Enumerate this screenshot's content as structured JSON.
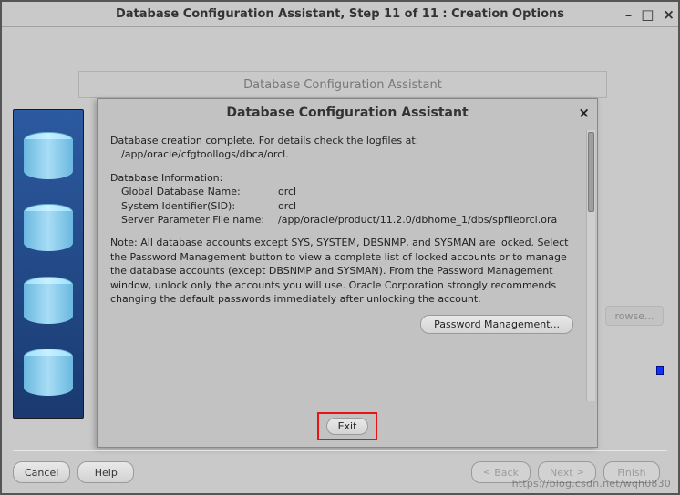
{
  "window": {
    "title": "Database Configuration Assistant, Step 11 of 11 : Creation Options"
  },
  "subwindow": {
    "title": "Database Configuration Assistant"
  },
  "modal": {
    "title": "Database Configuration Assistant",
    "close_glyph": "×",
    "creation_complete": "Database creation complete. For details check the logfiles at:",
    "logfiles_path": "/app/oracle/cfgtoollogs/dbca/orcl.",
    "db_info_heading": "Database Information:",
    "global_db_label": "Global Database Name:",
    "global_db_value": "orcl",
    "sid_label": "System Identifier(SID):",
    "sid_value": "orcl",
    "spfile_label": "Server Parameter File name:",
    "spfile_value": "/app/oracle/product/11.2.0/dbhome_1/dbs/spfileorcl.ora",
    "note": "Note: All database accounts except SYS, SYSTEM, DBSNMP, and SYSMAN are locked. Select the Password Management button to view a complete list of locked accounts or to manage the database accounts (except DBSNMP and SYSMAN). From the Password Management window, unlock only the accounts you will use. Oracle Corporation strongly recommends changing the default passwords immediately after unlocking the account.",
    "password_mgmt_label": "Password Management...",
    "exit_label": "Exit"
  },
  "peek": {
    "browse_label": "rowse..."
  },
  "bottombar": {
    "cancel": "Cancel",
    "help": "Help",
    "back": "Back",
    "next": "Next",
    "finish": "Finish"
  },
  "watermark": "https://blog.csdn.net/wqh0830"
}
